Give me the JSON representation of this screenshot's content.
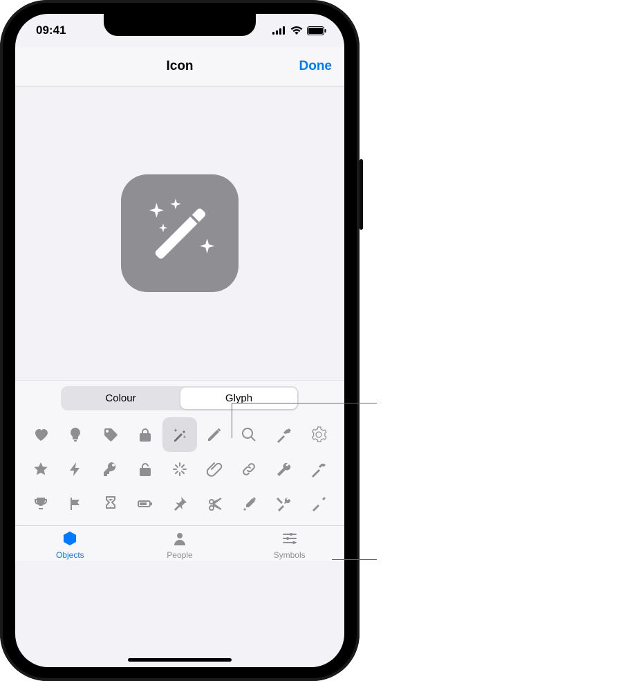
{
  "status": {
    "time": "09:41"
  },
  "nav": {
    "title": "Icon",
    "done": "Done"
  },
  "preview": {
    "selected_glyph_name": "wand-icon",
    "tile_color": "#8e8e93"
  },
  "segmented": {
    "items": [
      {
        "label": "Colour",
        "selected": false
      },
      {
        "label": "Glyph",
        "selected": true
      }
    ]
  },
  "glyph_grid": {
    "rows": 3,
    "cols": 9,
    "selected_index": 4,
    "items": [
      "heart-icon",
      "lightbulb-icon",
      "tag-icon",
      "lock-icon",
      "wand-icon",
      "pencil-icon",
      "magnifying-glass-icon",
      "hammer-angled-icon",
      "gear-icon",
      "star-icon",
      "bolt-icon",
      "key-icon",
      "unlock-icon",
      "sparkle-icon",
      "paperclip-icon",
      "link-icon",
      "wrench-icon",
      "hammer-icon",
      "trophy-icon",
      "flag-icon",
      "hourglass-icon",
      "battery-icon",
      "pushpin-icon",
      "scissors-icon",
      "eyedropper-icon",
      "tools-crossed-icon",
      "screwdriver-icon"
    ]
  },
  "tabs": {
    "items": [
      {
        "label": "Objects",
        "active": true,
        "icon": "cube-icon"
      },
      {
        "label": "People",
        "active": false,
        "icon": "person-icon"
      },
      {
        "label": "Symbols",
        "active": false,
        "icon": "sliders-icon"
      }
    ]
  }
}
